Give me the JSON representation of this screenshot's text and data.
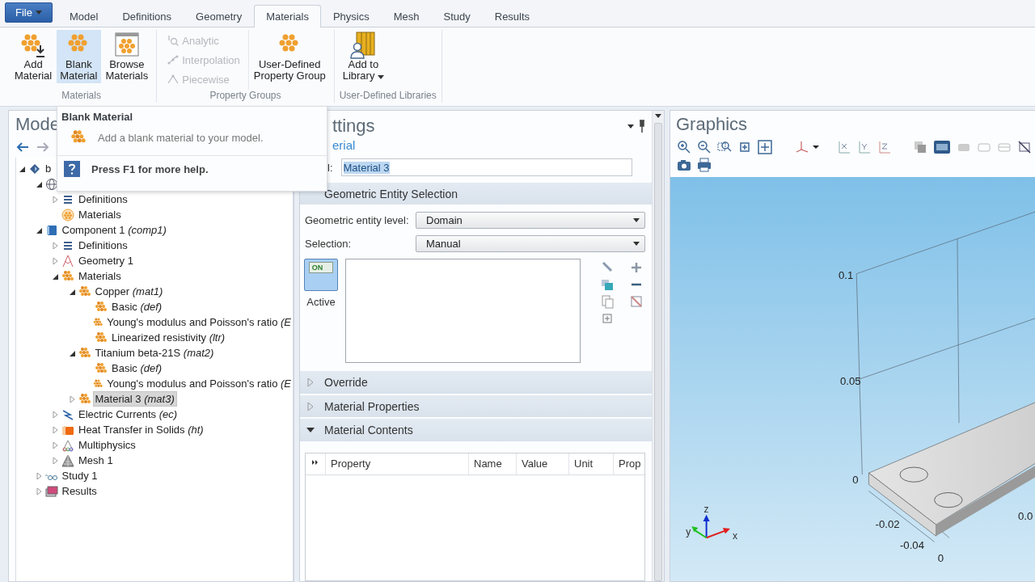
{
  "tabs": {
    "file": "File",
    "items": [
      {
        "label": "Model",
        "selected": false
      },
      {
        "label": "Definitions",
        "selected": false
      },
      {
        "label": "Geometry",
        "selected": false
      },
      {
        "label": "Materials",
        "selected": true
      },
      {
        "label": "Physics",
        "selected": false
      },
      {
        "label": "Mesh",
        "selected": false
      },
      {
        "label": "Study",
        "selected": false
      },
      {
        "label": "Results",
        "selected": false
      }
    ]
  },
  "ribbon": {
    "groups": [
      {
        "label": "Materials",
        "buttons": [
          {
            "kind": "add-material",
            "lines": [
              "Add",
              "Material"
            ],
            "hovered": false,
            "menu": false
          },
          {
            "kind": "material",
            "lines": [
              "Blank",
              "Material"
            ],
            "hovered": true,
            "menu": false
          },
          {
            "kind": "browse",
            "lines": [
              "Browse",
              "Materials"
            ],
            "hovered": false,
            "menu": false
          }
        ]
      },
      {
        "label": "Property Groups",
        "small": [
          {
            "label": "Analytic",
            "kind": "function",
            "disabled": true
          },
          {
            "label": "Interpolation",
            "kind": "interpolation",
            "disabled": true
          },
          {
            "label": "Piecewise",
            "kind": "piecewise",
            "disabled": true
          }
        ],
        "buttons": [
          {
            "kind": "material",
            "lines": [
              "User-Defined",
              "Property Group"
            ],
            "hovered": false,
            "menu": false
          }
        ]
      },
      {
        "label": "User-Defined Libraries",
        "buttons": [
          {
            "kind": "library",
            "lines": [
              "Add to",
              "Library"
            ],
            "hovered": false,
            "menu": true
          }
        ]
      }
    ]
  },
  "model_builder": {
    "title": "Mode",
    "tree": [
      {
        "label": "b",
        "kind": "root",
        "expanded": true,
        "selected": false,
        "children": [
          {
            "kind": "globe",
            "expanded": true,
            "children": [
              {
                "label": "Definitions",
                "kind": "definitions",
                "expanded": false,
                "selected": false
              },
              {
                "label": "Materials",
                "kind": "materials-global",
                "selected": false
              }
            ]
          },
          {
            "label": "Component 1 *(comp1)*",
            "kind": "component",
            "expanded": true,
            "selected": false,
            "children": [
              {
                "label": "Definitions",
                "kind": "definitions",
                "expanded": false,
                "selected": false
              },
              {
                "label": "Geometry 1",
                "kind": "geometry",
                "expanded": false,
                "selected": false
              },
              {
                "label": "Materials",
                "kind": "material",
                "expanded": true,
                "selected": false,
                "children": [
                  {
                    "label": "Copper *(mat1)*",
                    "kind": "material",
                    "expanded": true,
                    "selected": false,
                    "children": [
                      {
                        "label": "Basic *(def)*",
                        "kind": "material",
                        "selected": false
                      },
                      {
                        "label": "Young's modulus and Poisson's ratio *(E*",
                        "kind": "material",
                        "selected": false
                      },
                      {
                        "label": "Linearized resistivity *(ltr)*",
                        "kind": "material",
                        "selected": false
                      }
                    ]
                  },
                  {
                    "label": "Titanium beta-21S *(mat2)*",
                    "kind": "material",
                    "expanded": true,
                    "selected": false,
                    "children": [
                      {
                        "label": "Basic *(def)*",
                        "kind": "material",
                        "selected": false
                      },
                      {
                        "label": "Young's modulus and Poisson's ratio *(E*",
                        "kind": "material",
                        "selected": false
                      }
                    ]
                  },
                  {
                    "label": "Material 3 *(mat3)*",
                    "kind": "material",
                    "expanded": false,
                    "selected": true
                  }
                ]
              },
              {
                "label": "Electric Currents *(ec)*",
                "kind": "electric",
                "expanded": false,
                "selected": false
              },
              {
                "label": "Heat Transfer in Solids *(ht)*",
                "kind": "heat",
                "expanded": false,
                "selected": false
              },
              {
                "label": "Multiphysics",
                "kind": "multiphysics",
                "expanded": false,
                "selected": false
              },
              {
                "label": "Mesh 1",
                "kind": "mesh",
                "expanded": false,
                "selected": false
              }
            ]
          },
          {
            "label": "Study 1",
            "kind": "study",
            "expanded": false,
            "selected": false
          },
          {
            "label": "Results",
            "kind": "results",
            "expanded": false,
            "selected": false
          }
        ]
      }
    ]
  },
  "tooltip": {
    "title": "Blank Material",
    "description": "Add a blank material to your model.",
    "help": "Press F1 for more help."
  },
  "settings": {
    "title": "ttings",
    "subtitle": "erial",
    "label_caption": "l:",
    "label_value": "Material 3",
    "selection_section": {
      "title": "Geometric Entity Selection",
      "fields": [
        {
          "label": "Geometric entity level:",
          "value": "Domain"
        },
        {
          "label": "Selection:",
          "value": "Manual"
        }
      ],
      "active": {
        "label": "Active",
        "toggle_text": "ON",
        "on": true
      }
    },
    "sections": [
      {
        "title": "Override",
        "expanded": false
      },
      {
        "title": "Material Properties",
        "expanded": false
      },
      {
        "title": "Material Contents",
        "expanded": true,
        "columns": [
          "Property",
          "Name",
          "Value",
          "Unit",
          "Prop"
        ]
      }
    ]
  },
  "graphics": {
    "title": "Graphics",
    "ticks": [
      "0.1",
      "0.05",
      "0",
      "-0.02",
      "-0.04",
      "0",
      "0.0"
    ],
    "axes": [
      "z",
      "y",
      "x"
    ]
  }
}
